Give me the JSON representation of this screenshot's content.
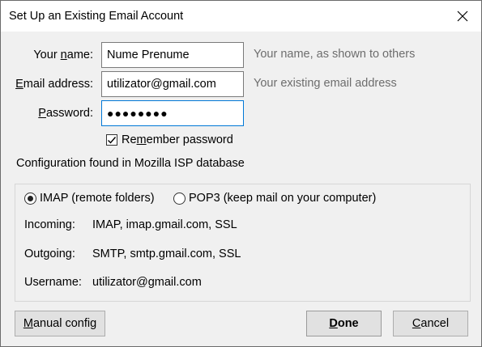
{
  "window": {
    "title": "Set Up an Existing Email Account"
  },
  "form": {
    "name_label_pre": "Your ",
    "name_label_key": "n",
    "name_label_post": "ame:",
    "name_value": "Nume Prenume",
    "name_hint": "Your name, as shown to others",
    "email_label_key": "E",
    "email_label_post": "mail address:",
    "email_value": "utilizator@gmail.com",
    "email_hint": "Your existing email address",
    "password_label_key": "P",
    "password_label_post": "assword:",
    "password_value": "●●●●●●●●",
    "remember_pre": "Re",
    "remember_key": "m",
    "remember_post": "ember password",
    "remember_checked": true
  },
  "config_message": "Configuration found in Mozilla ISP database",
  "protocols": {
    "imap_label": "IMAP (remote folders)",
    "pop3_label": "POP3 (keep mail on your computer)",
    "selected": "imap"
  },
  "details": {
    "incoming_label": "Incoming:",
    "incoming_value": "IMAP, imap.gmail.com, SSL",
    "outgoing_label": "Outgoing:",
    "outgoing_value": "SMTP, smtp.gmail.com, SSL",
    "username_label": "Username:",
    "username_value": "utilizator@gmail.com"
  },
  "buttons": {
    "manual_key": "M",
    "manual_post": "anual config",
    "done_key": "D",
    "done_post": "one",
    "cancel_pre": "",
    "cancel_key": "C",
    "cancel_post": "ancel"
  }
}
